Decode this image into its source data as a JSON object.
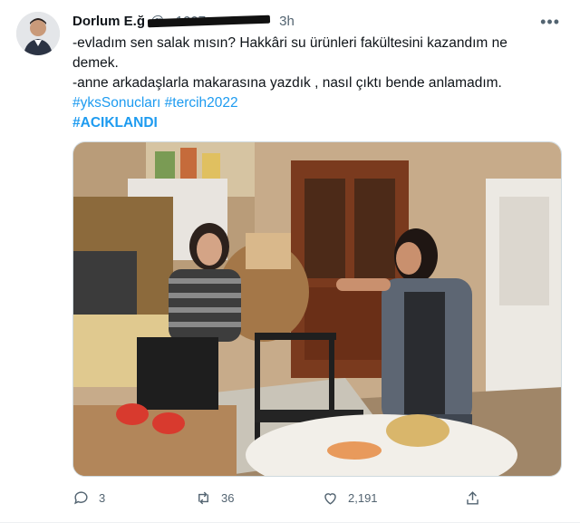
{
  "tweet": {
    "author_name": "Dorlum E.ğ",
    "author_handle": "@...1007",
    "timestamp": "3h",
    "lines": [
      "-evladım sen salak mısın? Hakkâri su ürünleri fakültesini kazandım ne demek.",
      "-anne arkadaşlarla makarasına yazdık , nasıl çıktı bende anlamadım."
    ],
    "hashtags_line": "#yksSonucları #tercih2022",
    "hashtag_caps": "#ACIKLANDI",
    "more_icon": "more-horizontal-icon"
  },
  "actions": {
    "replies": "3",
    "retweets": "36",
    "likes": "2,191"
  },
  "colors": {
    "link": "#1d9bf0",
    "secondary_text": "#536471"
  }
}
